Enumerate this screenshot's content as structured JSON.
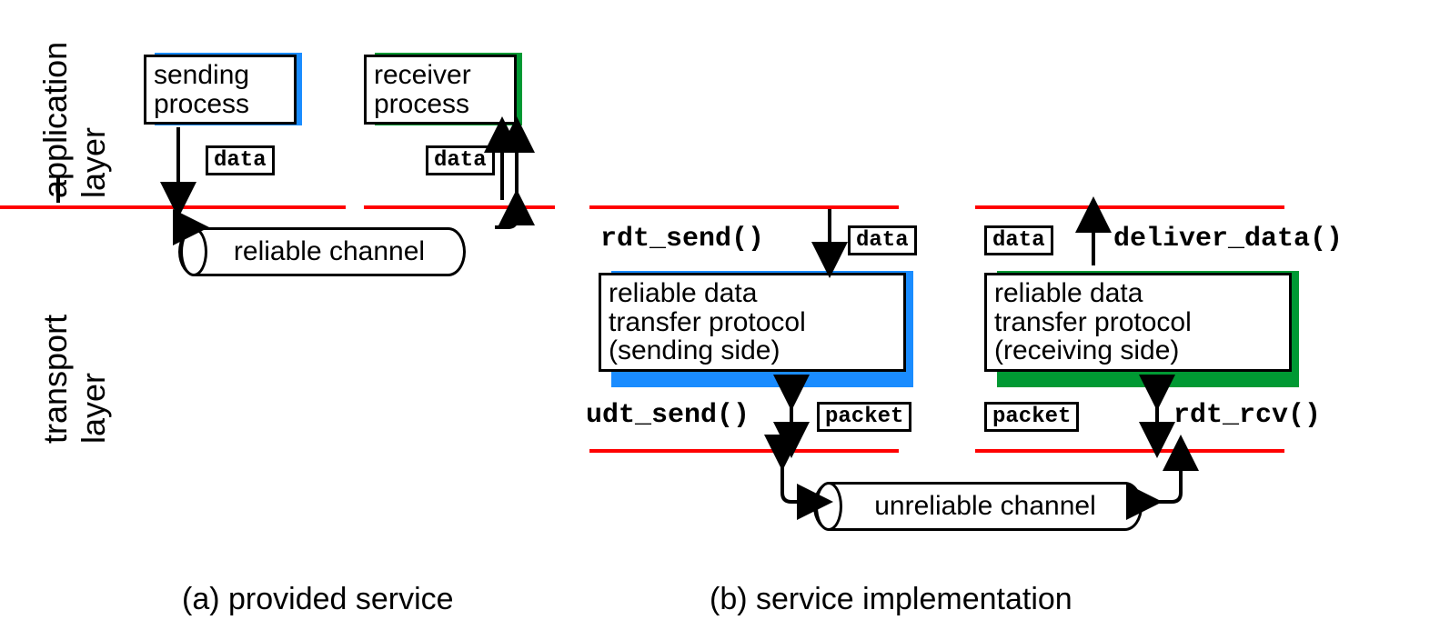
{
  "layers": {
    "application": "application\nlayer",
    "transport": "transport\nlayer"
  },
  "panelA": {
    "sender_box": "sending\nprocess",
    "receiver_box": "receiver\nprocess",
    "data1": "data",
    "data2": "data",
    "channel": "reliable channel",
    "caption": "(a)  provided service"
  },
  "panelB": {
    "rdt_send": "rdt_send()",
    "deliver_data": "deliver_data()",
    "data1": "data",
    "data2": "data",
    "sender_box": "reliable data\ntransfer protocol\n(sending side)",
    "receiver_box": "reliable data\ntransfer protocol\n(receiving side)",
    "udt_send": "udt_send()",
    "rdt_rcv": "rdt_rcv()",
    "packet1": "packet",
    "packet2": "packet",
    "channel": "unreliable channel",
    "caption": "(b) service implementation"
  },
  "colors": {
    "red": "#ff0000",
    "blue": "#1a8cff",
    "green": "#009933"
  }
}
